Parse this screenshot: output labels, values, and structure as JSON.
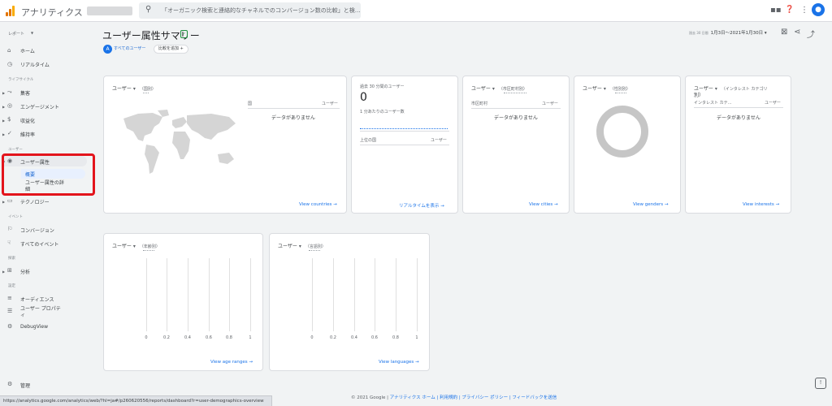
{
  "topbar": {
    "app_title": "アナリティクス",
    "search_text": "「オーガニック検索と連絡的なチャネルでのコンバージョン数の比較」と検…",
    "icons": [
      "grid-icon",
      "help-icon",
      "more-icon",
      "avatar-icon"
    ],
    "logo_colors": [
      "#f9ab00",
      "#e37400",
      "#e37400"
    ]
  },
  "sidebar": {
    "reports_label": "レポート",
    "home": "ホーム",
    "realtime": "リアルタイム",
    "lifecycle_label": "ライフサイクル",
    "acquisition": "集客",
    "engagement": "エンゲージメント",
    "monetization": "収益化",
    "retention": "維持率",
    "user_label": "ユーザー",
    "user_attributes": "ユーザー属性",
    "overview": "概要",
    "user_attr_detail": "ユーザー属性の詳細",
    "tech": "テクノロジー",
    "events_label": "イベント",
    "conversions": "コンバージョン",
    "all_events": "すべてのイベント",
    "explore_label": "探索",
    "analysis": "分析",
    "config_label": "設定",
    "audiences": "オーディエンス",
    "user_props": "ユーザー プロパティ",
    "debugview": "DebugView",
    "admin": "管理"
  },
  "header": {
    "page_title": "ユーザー属性サマリー",
    "chip_all_users": "すべてのユーザー",
    "chip_compare": "比較を追加",
    "date_prefix": "過去 30 日間",
    "date_range": "1月3日～2021年1月30日",
    "accent_color": "#1a73e8"
  },
  "cards": {
    "country": {
      "metric": "ユーザー",
      "dim": "（国別）",
      "col1": "国",
      "col2": "ユーザー",
      "nodata": "データがありません",
      "link": "View countries →"
    },
    "realtime": {
      "title": "過去 30 分間のユーザー",
      "value": "0",
      "sub": "1 分あたりのユーザー数",
      "col1": "上位の国",
      "col2": "ユーザー",
      "link": "リアルタイムを表示 →"
    },
    "city": {
      "metric": "ユーザー",
      "dim": "（市区町村別）",
      "col1": "市区町村",
      "col2": "ユーザー",
      "nodata": "データがありません",
      "link": "View cities →"
    },
    "gender": {
      "metric": "ユーザー",
      "dim": "（性別別）",
      "link": "View genders →"
    },
    "interest": {
      "metric": "ユーザー",
      "dim": "（インタレスト カテゴリ",
      "dim2": "別）",
      "col1": "インタレスト カテ…",
      "col2": "ユーザー",
      "nodata": "データがありません",
      "link": "View interests →"
    },
    "age": {
      "metric": "ユーザー",
      "dim": "（年齢別）",
      "ticks": [
        "0",
        "0.2",
        "0.4",
        "0.6",
        "0.8",
        "1"
      ],
      "link": "View age ranges →"
    },
    "language": {
      "metric": "ユーザー",
      "dim": "（言語別）",
      "ticks": [
        "0",
        "0.2",
        "0.4",
        "0.6",
        "0.8",
        "1"
      ],
      "link": "View languages →"
    }
  },
  "footer": {
    "copyright": "© 2021 Google | ",
    "links": "アナリティクス ホーム | 利用規約 | プライバシー ポリシー | フィードバックを送信",
    "status_url": "https://analytics.google.com/analytics/web/?hl=ja#/p260620556/reports/dashboard?r=user-demographics-overview"
  }
}
